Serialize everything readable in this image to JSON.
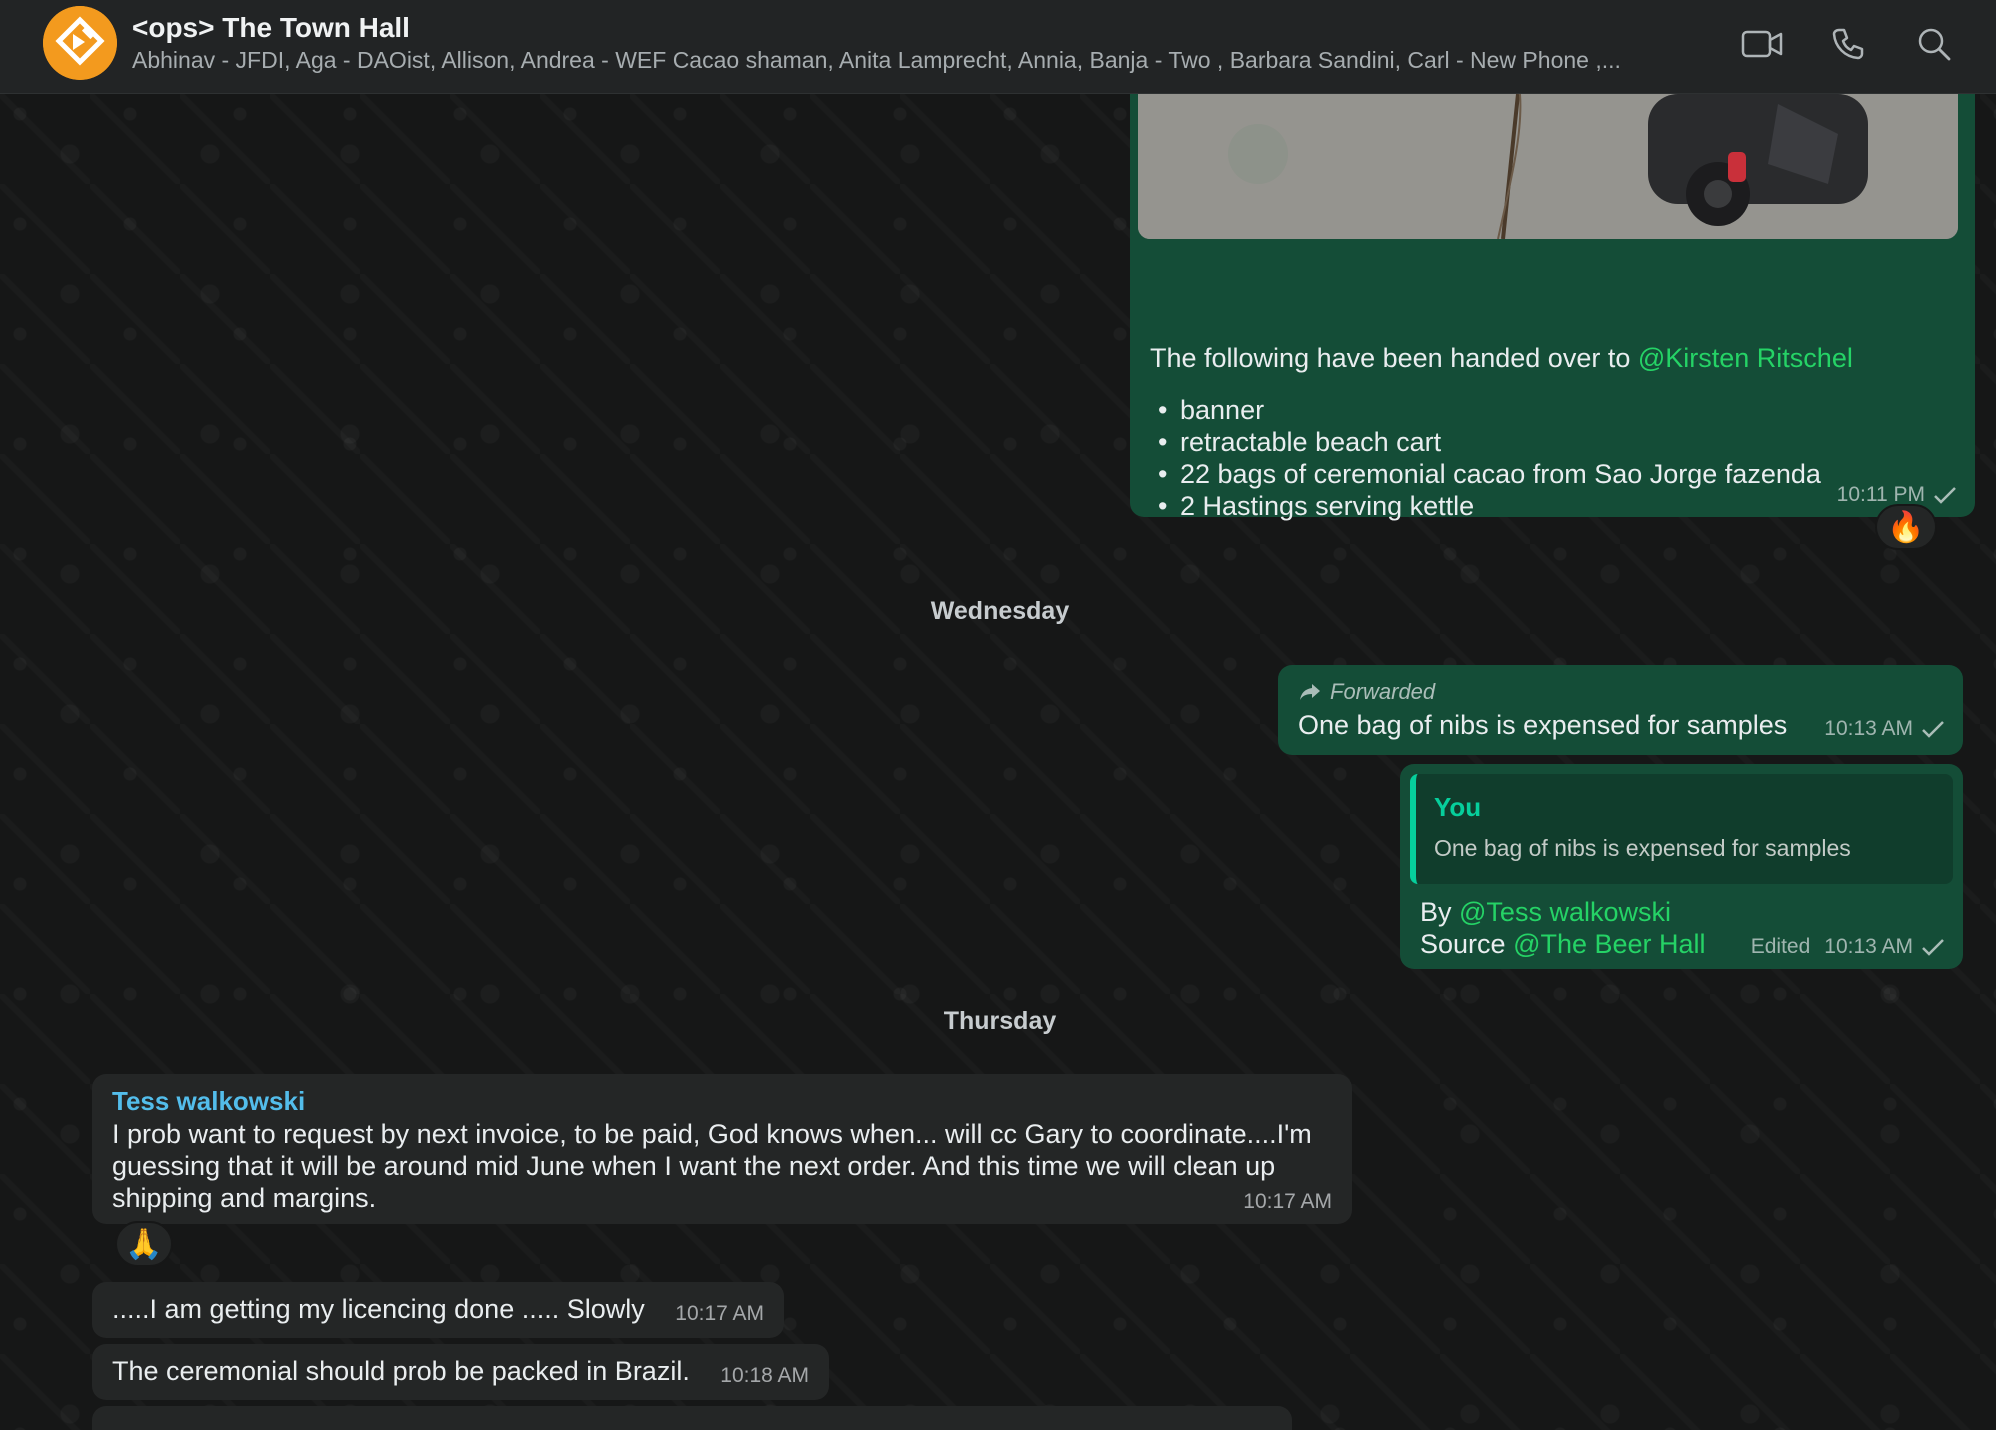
{
  "header": {
    "title": "<ops> The Town Hall",
    "members": "Abhinav - JFDI, Aga - DAOist, Allison, Andrea - WEF Cacao shaman, Anita Lamprecht, Annia, Banja - Two , Barbara Sandini, Carl - New Phone ,..."
  },
  "msg1": {
    "intro": "The following have been handed over to ",
    "mention": "@Kirsten Ritschel",
    "items": [
      "banner",
      "retractable beach cart",
      "22 bags of ceremonial cacao from Sao Jorge fazenda",
      "2 Hastings serving kettle"
    ],
    "time": "10:11 PM",
    "reaction": "🔥"
  },
  "date1": "Wednesday",
  "msg2": {
    "forwarded_label": "Forwarded",
    "text": "One bag of nibs is expensed for samples",
    "time": "10:13 AM"
  },
  "msg3": {
    "quote_author": "You",
    "quote_text": "One bag of nibs is expensed for samples",
    "by_label": "By ",
    "by_mention": "@Tess walkowski",
    "source_label": "Source ",
    "source_mention": "@The Beer Hall",
    "edited": "Edited",
    "time": "10:13 AM"
  },
  "date2": "Thursday",
  "msg4": {
    "sender": "Tess walkowski",
    "line1": "I prob want to request by next invoice, to be paid, God knows when... will cc Gary to coordinate....I'm",
    "line2": "guessing that it will be around mid June when I want the next order.   And this time we will clean up",
    "line3": "shipping and margins.",
    "time": "10:17 AM",
    "reaction": "🙏"
  },
  "msg5": {
    "text": ".....I am getting my licencing done ..... Slowly",
    "time": "10:17 AM"
  },
  "msg6": {
    "text": "The ceremonial should prob be packed in Brazil.",
    "time": "10:18 AM"
  },
  "colors": {
    "outgoing_bubble": "#144d37",
    "incoming_bubble": "#242626",
    "mention": "#25d366",
    "sender": "#53bdeb",
    "avatar": "#f39a1e"
  },
  "icons": [
    "group-avatar",
    "video-call-icon",
    "voice-call-icon",
    "search-icon",
    "check-icon",
    "forward-icon"
  ]
}
